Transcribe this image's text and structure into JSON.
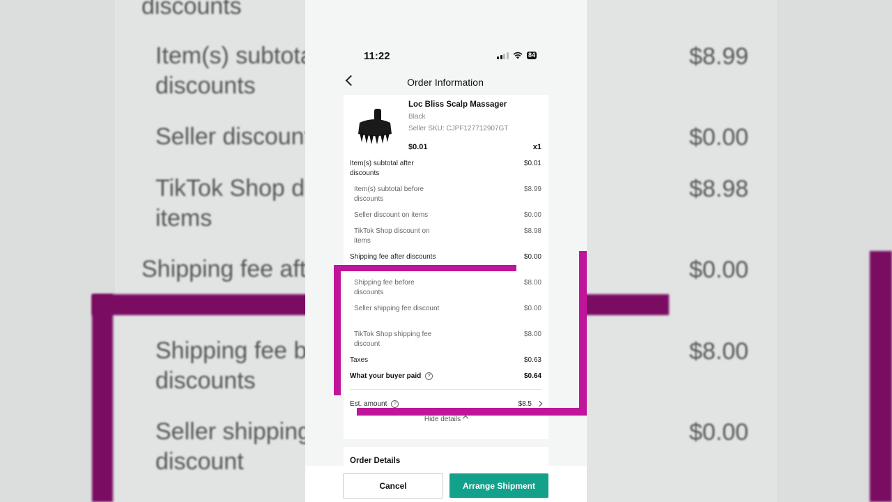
{
  "status_bar": {
    "time": "11:22",
    "battery": "84"
  },
  "nav": {
    "title": "Order Information"
  },
  "product": {
    "name": "Loc Bliss Scalp Massager",
    "variant": "Black",
    "sku": "Seller SKU: CJPF127712907GT",
    "price": "$0.01",
    "quantity": "x1"
  },
  "breakdown": [
    {
      "label": "Item(s) subtotal after discounts",
      "value": "$0.01"
    },
    {
      "label": "Item(s) subtotal before discounts",
      "value": "$8.99"
    },
    {
      "label": "Seller discount on items",
      "value": "$0.00"
    },
    {
      "label": "TikTok Shop discount on items",
      "value": "$8.98"
    },
    {
      "label": "Shipping fee after discounts",
      "value": "$0.00"
    },
    {
      "label": "Shipping fee before discounts",
      "value": "$8.00"
    },
    {
      "label": "Seller shipping fee discount",
      "value": "$0.00"
    },
    {
      "label": "TikTok Shop shipping fee discount",
      "value": "$8.00"
    },
    {
      "label": "Taxes",
      "value": "$0.63"
    },
    {
      "label": "What your buyer paid",
      "value": "$0.64"
    }
  ],
  "estimate": {
    "label": "Est. amount",
    "value": "$8.5"
  },
  "hide_details": "Hide details",
  "order_details_title": "Order Details",
  "buttons": {
    "cancel": "Cancel",
    "arrange": "Arrange Shipment"
  },
  "background_zoom": {
    "lines": [
      "discounts",
      "Item(s) subtota",
      "discounts",
      "Seller discount",
      "TikTok Shop di",
      "items",
      "Shipping fee aft",
      "Shipping fee b",
      "discounts",
      "Seller shipping",
      "discount"
    ],
    "values": [
      "$8.99",
      "$0.00",
      "$8.98",
      "$0.00",
      "$8.00",
      "$0.00"
    ]
  },
  "colors": {
    "accent": "#13a18b",
    "highlight": "#c0149a"
  }
}
